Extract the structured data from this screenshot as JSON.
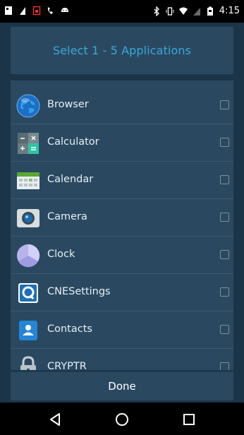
{
  "status_bar": {
    "time": "4:15",
    "left_icons": [
      "notification-icon",
      "phone-signal-icon",
      "sim-icon",
      "call-icon",
      "android-icon"
    ],
    "right_icons": [
      "bluetooth-icon",
      "vibrate-icon",
      "wifi-icon",
      "signal-icon",
      "battery-icon"
    ]
  },
  "dialog": {
    "title": "Select 1 - 5 Applications",
    "apps": [
      {
        "label": "Browser",
        "icon": "browser-icon",
        "checked": false
      },
      {
        "label": "Calculator",
        "icon": "calculator-icon",
        "checked": false
      },
      {
        "label": "Calendar",
        "icon": "calendar-icon",
        "checked": false
      },
      {
        "label": "Camera",
        "icon": "camera-icon",
        "checked": false
      },
      {
        "label": "Clock",
        "icon": "clock-icon",
        "checked": false
      },
      {
        "label": "CNESettings",
        "icon": "cnesettings-icon",
        "checked": false
      },
      {
        "label": "Contacts",
        "icon": "contacts-icon",
        "checked": false
      },
      {
        "label": "CRYPTR",
        "icon": "cryptr-icon",
        "checked": false
      }
    ],
    "done_label": "Done"
  },
  "nav_bar": {
    "buttons": [
      "back-icon",
      "home-icon",
      "recents-icon"
    ]
  },
  "colors": {
    "title_text": "#3aa8d8",
    "panel": "#2a4961",
    "background": "#1b3448"
  }
}
